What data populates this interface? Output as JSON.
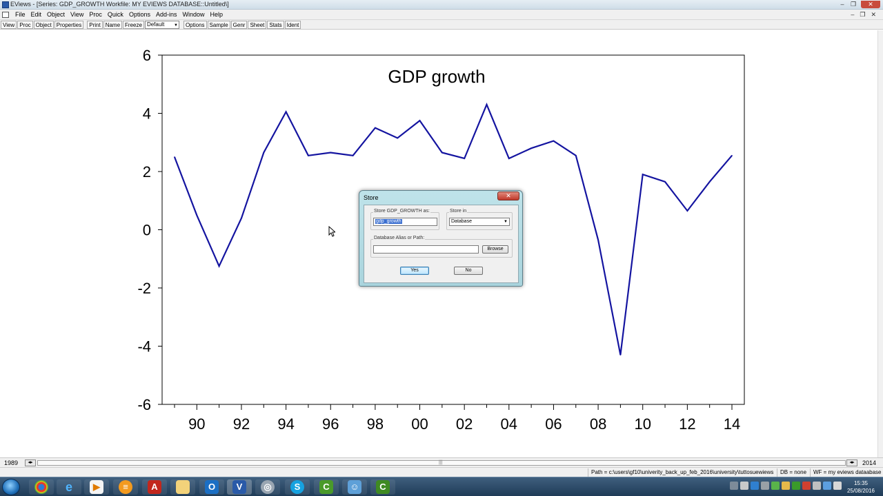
{
  "window": {
    "title": "EViews - [Series: GDP_GROWTH   Workfile: MY EVIEWS DATABASE::Untitled\\]",
    "controls": [
      "–",
      "❐",
      "✕"
    ]
  },
  "menu": {
    "items": [
      "File",
      "Edit",
      "Object",
      "View",
      "Proc",
      "Quick",
      "Options",
      "Add-ins",
      "Window",
      "Help"
    ],
    "mdi_controls": [
      "–",
      "❐",
      "✕"
    ]
  },
  "toolbar": {
    "buttons_left": [
      "View",
      "Proc",
      "Object",
      "Properties"
    ],
    "buttons_mid": [
      "Print",
      "Name",
      "Freeze"
    ],
    "select_value": "Default",
    "buttons_right": [
      "Options",
      "Sample",
      "Genr",
      "Sheet",
      "Stats",
      "Ident"
    ]
  },
  "chart_data": {
    "type": "line",
    "title": "GDP growth",
    "xlabel": "",
    "ylabel": "",
    "ylim": [
      -6,
      6
    ],
    "yticks": [
      6,
      4,
      2,
      0,
      -2,
      -4,
      -6
    ],
    "xlim": [
      1988.5,
      2014.5
    ],
    "xtick_labels": [
      "90",
      "92",
      "94",
      "96",
      "98",
      "00",
      "02",
      "04",
      "06",
      "08",
      "10",
      "12",
      "14"
    ],
    "xtick_years": [
      1990,
      1992,
      1994,
      1996,
      1998,
      2000,
      2002,
      2004,
      2006,
      2008,
      2010,
      2012,
      2014
    ],
    "grid": false,
    "legend": "none",
    "line_color": "#1414a0",
    "x": [
      1989,
      1990,
      1991,
      1992,
      1993,
      1994,
      1995,
      1996,
      1997,
      1998,
      1999,
      2000,
      2001,
      2002,
      2003,
      2004,
      2005,
      2006,
      2007,
      2008,
      2009,
      2010,
      2011,
      2012,
      2013,
      2014
    ],
    "values": [
      2.5,
      0.5,
      -1.25,
      0.4,
      2.65,
      4.05,
      2.55,
      2.65,
      2.55,
      3.5,
      3.15,
      3.75,
      2.65,
      2.45,
      4.3,
      2.45,
      2.8,
      3.05,
      2.55,
      -0.35,
      -4.3,
      1.9,
      1.65,
      0.65,
      1.65,
      2.55
    ]
  },
  "dialog": {
    "title": "Store",
    "close": "✕",
    "store_as_label": "Store GDP_GROWTH as:",
    "store_as_value": "gdp_growth",
    "store_in_label": "Store in",
    "store_in_value": "Database",
    "path_label": "Database Alias or Path:",
    "path_value": "",
    "browse_label": "Browse",
    "yes_label": "Yes",
    "no_label": "No"
  },
  "samplebar": {
    "start": "1989",
    "end": "2014"
  },
  "statusbar": {
    "path": "Path = c:\\users\\gf10\\univerity_back_up_feb_2016\\university\\tuttosuewiews",
    "db": "DB = none",
    "wf": "WF = my eviews dataabase"
  },
  "taskbar": {
    "time": "15:35",
    "date": "25/08/2016"
  }
}
